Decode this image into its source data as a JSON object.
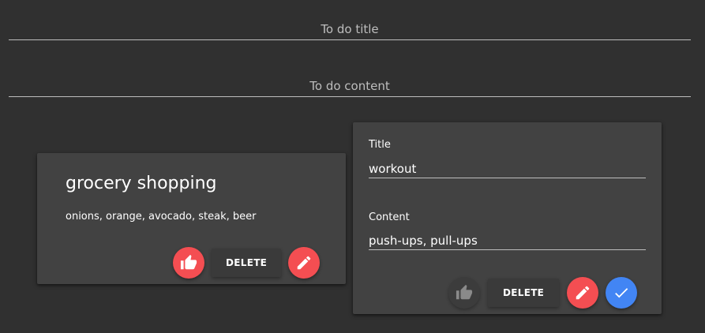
{
  "new_todo": {
    "title_placeholder": "To do title",
    "content_placeholder": "To do content"
  },
  "notes": [
    {
      "title": "grocery shopping",
      "content": "onions, orange, avocado, steak, beer",
      "delete_label": "DELETE",
      "like_icon": "thumb-up-icon",
      "edit_icon": "pencil-icon"
    }
  ],
  "edit_note": {
    "title_label": "Title",
    "title_value": "workout",
    "content_label": "Content",
    "content_value": "push-ups, pull-ups",
    "delete_label": "DELETE",
    "like_icon": "thumb-up-icon",
    "edit_icon": "pencil-icon",
    "save_icon": "check-icon"
  },
  "colors": {
    "background": "#303030",
    "card": "#424242",
    "accent_red": "#f44e52",
    "accent_blue": "#4285f4"
  }
}
